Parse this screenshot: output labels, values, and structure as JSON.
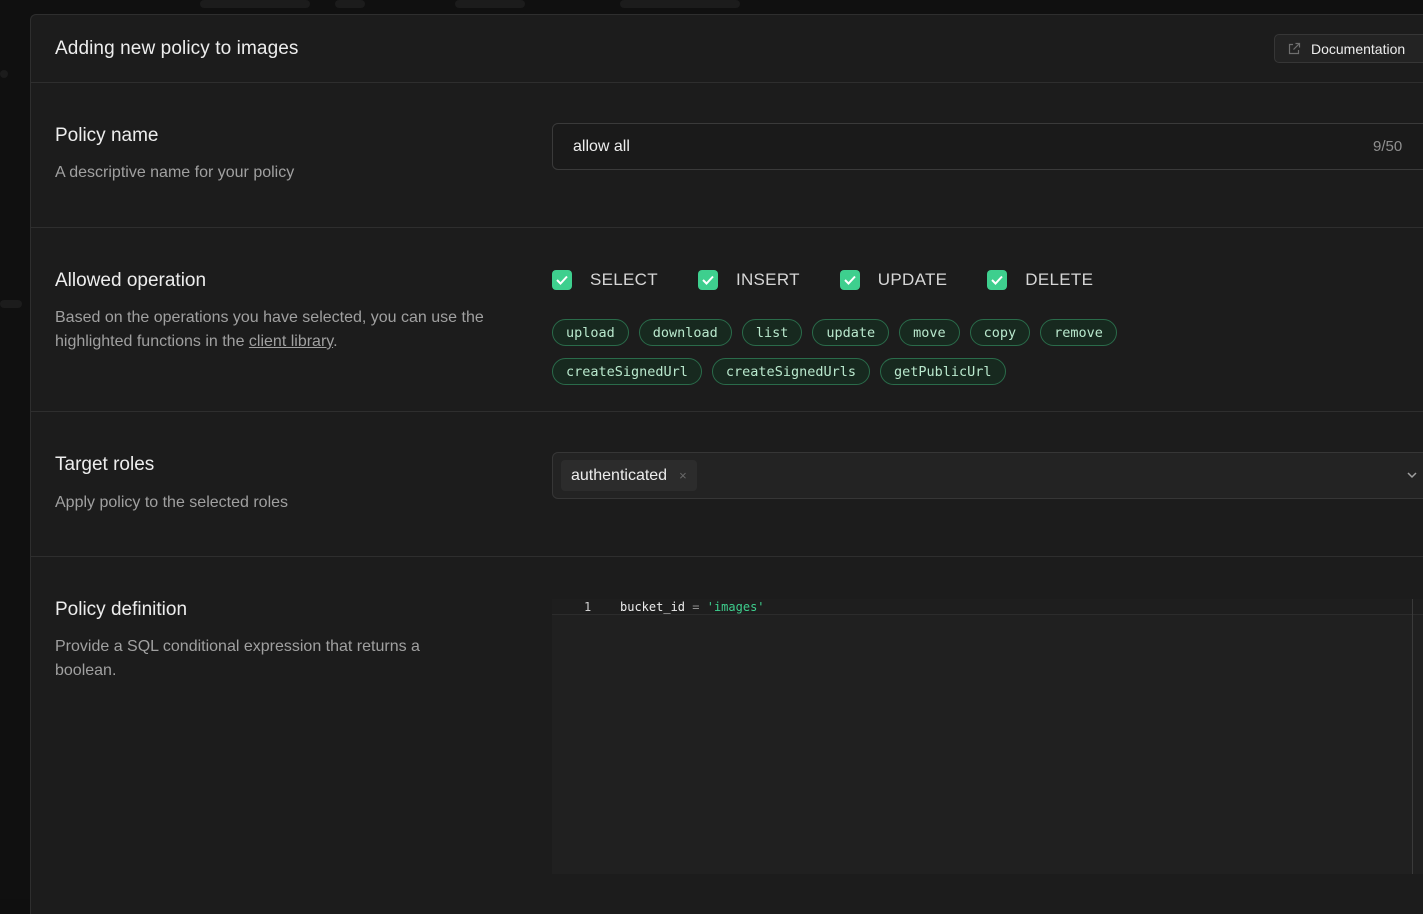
{
  "modal": {
    "title": "Adding new policy to images",
    "documentation_label": "Documentation"
  },
  "policy_name": {
    "title": "Policy name",
    "description": "A descriptive name for your policy",
    "value": "allow all",
    "counter": "9/50"
  },
  "allowed_operation": {
    "title": "Allowed operation",
    "description_prefix": "Based on the operations you have selected, you can use the highlighted functions in the ",
    "description_link": "client library",
    "description_suffix": ".",
    "operations": [
      {
        "label": "SELECT",
        "checked": true
      },
      {
        "label": "INSERT",
        "checked": true
      },
      {
        "label": "UPDATE",
        "checked": true
      },
      {
        "label": "DELETE",
        "checked": true
      }
    ],
    "functions_row1": [
      "upload",
      "download",
      "list",
      "update",
      "move",
      "copy",
      "remove"
    ],
    "functions_row2": [
      "createSignedUrl",
      "createSignedUrls",
      "getPublicUrl"
    ]
  },
  "target_roles": {
    "title": "Target roles",
    "description": "Apply policy to the selected roles",
    "selected_role": "authenticated",
    "remove_glyph": "×"
  },
  "policy_definition": {
    "title": "Policy definition",
    "description": "Provide a SQL conditional expression that returns a boolean.",
    "line_number": "1",
    "code_ident": "bucket_id",
    "code_op": "=",
    "code_string": "'images'"
  },
  "colors": {
    "accent": "#3ecf8e",
    "background": "#1c1c1c",
    "border": "#2e2e2e"
  }
}
